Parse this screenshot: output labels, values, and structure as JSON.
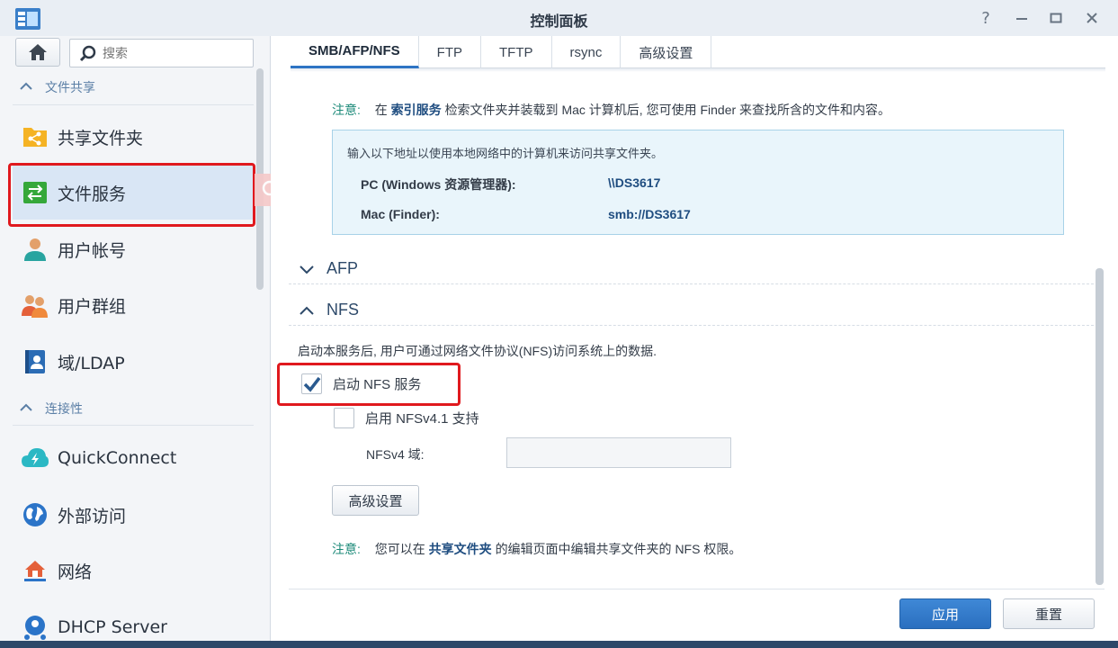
{
  "window": {
    "title": "控制面板"
  },
  "sidebar": {
    "search_placeholder": "搜索",
    "section_file_sharing": "文件共享",
    "section_connectivity": "连接性",
    "items": [
      {
        "label": "共享文件夹",
        "icon": "shared-folder-icon"
      },
      {
        "label": "文件服务",
        "icon": "file-services-icon"
      },
      {
        "label": "用户帐号",
        "icon": "user-icon"
      },
      {
        "label": "用户群组",
        "icon": "group-icon"
      },
      {
        "label": "域/LDAP",
        "icon": "ldap-icon"
      },
      {
        "label": "QuickConnect",
        "icon": "quickconnect-icon"
      },
      {
        "label": "外部访问",
        "icon": "globe-icon"
      },
      {
        "label": "网络",
        "icon": "network-icon"
      },
      {
        "label": "DHCP Server",
        "icon": "dhcp-icon"
      }
    ]
  },
  "tabs": [
    "SMB/AFP/NFS",
    "FTP",
    "TFTP",
    "rsync",
    "高级设置"
  ],
  "content": {
    "note1": {
      "label": "注意:",
      "pre": "在",
      "link": "索引服务",
      "post": "检索文件夹并装载到 Mac 计算机后, 您可使用 Finder 来查找所含的文件和内容。"
    },
    "info": {
      "intro": "输入以下地址以使用本地网络中的计算机来访问共享文件夹。",
      "pc_key": "PC (Windows 资源管理器):",
      "pc_value": "\\\\DS3617",
      "mac_key": "Mac (Finder):",
      "mac_value": "smb://DS3617"
    },
    "afp_title": "AFP",
    "nfs_title": "NFS",
    "nfs_desc": "启动本服务后, 用户可通过网络文件协议(NFS)访问系统上的数据.",
    "enable_nfs": {
      "label": "启动 NFS 服务",
      "checked": true
    },
    "enable_nfsv41": {
      "label": "启用 NFSv4.1 支持",
      "checked": false
    },
    "nfsv4_domain_label": "NFSv4 域:",
    "nfsv4_domain_value": "",
    "advanced_button": "高级设置",
    "note2": {
      "label": "注意:",
      "pre": "您可以在",
      "link": "共享文件夹",
      "post": "的编辑页面中编辑共享文件夹的 NFS 权限。"
    }
  },
  "footer": {
    "apply": "应用",
    "reset": "重置"
  },
  "colors": {
    "accent": "#2d74c4",
    "highlight": "#e0191e",
    "note_label": "#1c8a79"
  }
}
